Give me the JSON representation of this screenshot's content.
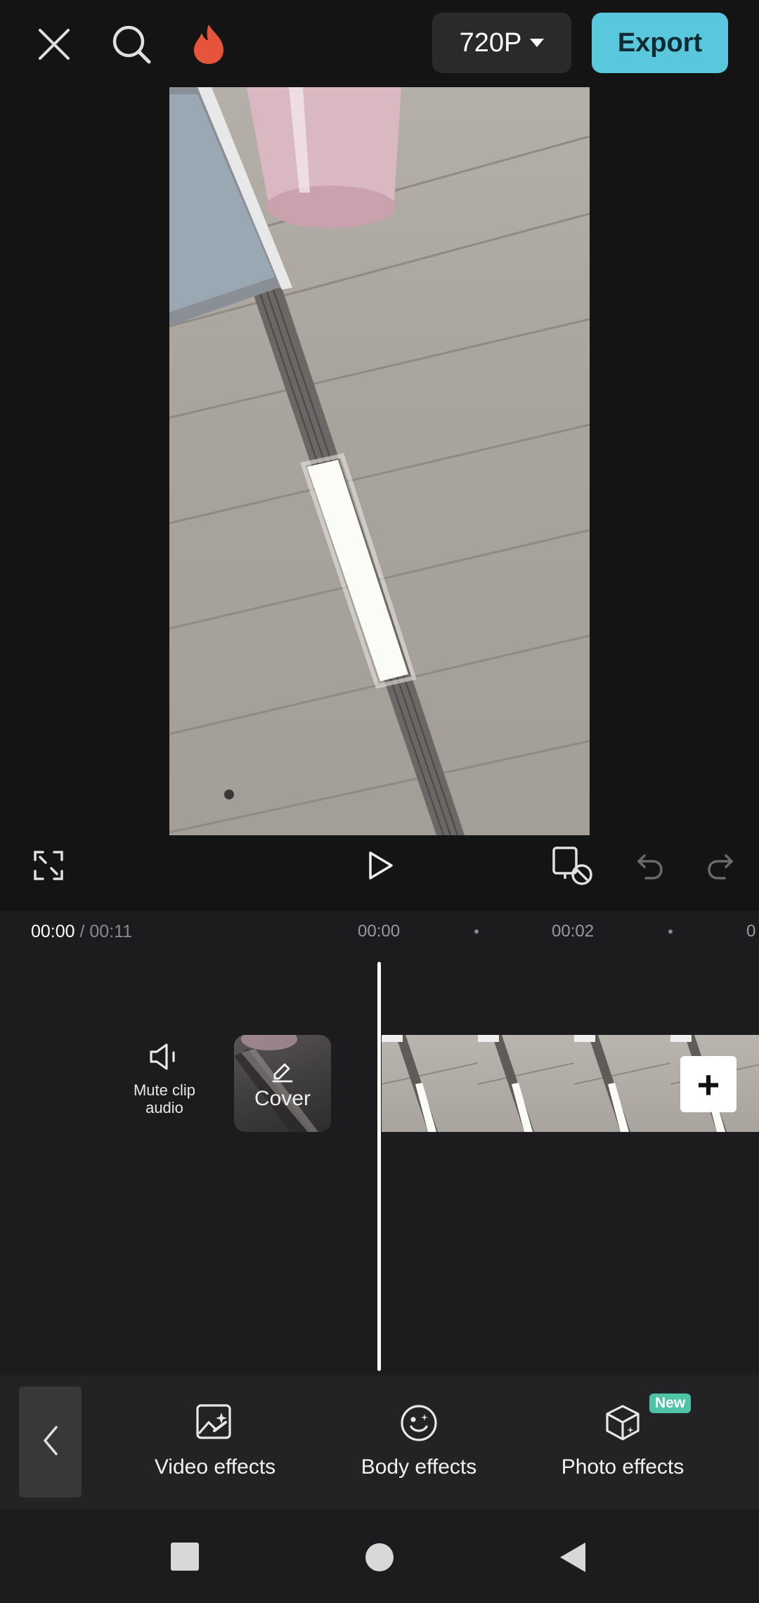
{
  "top_bar": {
    "resolution_label": "720P",
    "export_label": "Export"
  },
  "timeline": {
    "current_time": "00:00",
    "total_time": "/ 00:11",
    "ruler_labels": [
      "00:00",
      "00:02",
      "0"
    ]
  },
  "track": {
    "mute_label": "Mute clip audio",
    "cover_label": "Cover",
    "add_label": "+"
  },
  "toolbar": {
    "items": [
      {
        "label": "Video effects",
        "icon": "video-effects-icon"
      },
      {
        "label": "Body effects",
        "icon": "body-effects-icon"
      },
      {
        "label": "Photo effects",
        "icon": "photo-effects-icon"
      }
    ],
    "new_badge": "New"
  },
  "colors": {
    "export_bg": "#5ac8dc",
    "background": "#141414",
    "timeline_bg": "#1c1c1e",
    "new_badge": "#4fc3a8",
    "fire": "#e6553b"
  }
}
